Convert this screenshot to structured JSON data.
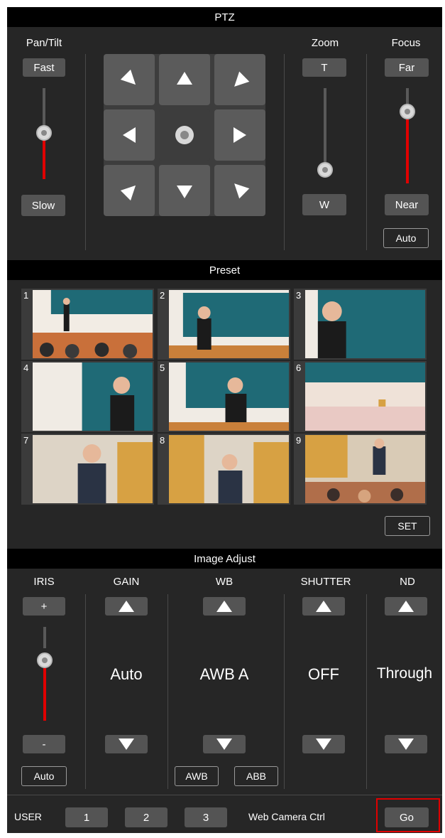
{
  "ptz": {
    "title": "PTZ",
    "pan_tilt": {
      "label": "Pan/Tilt",
      "fast": "Fast",
      "slow": "Slow"
    },
    "zoom": {
      "label": "Zoom",
      "tele": "T",
      "wide": "W"
    },
    "focus": {
      "label": "Focus",
      "far": "Far",
      "near": "Near",
      "auto": "Auto"
    }
  },
  "preset": {
    "title": "Preset",
    "items": [
      {
        "number": "1"
      },
      {
        "number": "2"
      },
      {
        "number": "3"
      },
      {
        "number": "4"
      },
      {
        "number": "5"
      },
      {
        "number": "6"
      },
      {
        "number": "7"
      },
      {
        "number": "8"
      },
      {
        "number": "9"
      }
    ],
    "set_label": "SET"
  },
  "image_adjust": {
    "title": "Image Adjust",
    "iris": {
      "label": "IRIS",
      "plus": "+",
      "minus": "-",
      "auto": "Auto"
    },
    "gain": {
      "label": "GAIN",
      "value": "Auto"
    },
    "wb": {
      "label": "WB",
      "value": "AWB A",
      "awb": "AWB",
      "abb": "ABB"
    },
    "shutter": {
      "label": "SHUTTER",
      "value": "OFF"
    },
    "nd": {
      "label": "ND",
      "value": "Through"
    }
  },
  "footer": {
    "user_label": "USER",
    "user_buttons": [
      "1",
      "2",
      "3"
    ],
    "web_camera_label": "Web Camera Ctrl",
    "go_label": "Go"
  },
  "colors": {
    "background": "#262626",
    "header": "#000000",
    "button": "#545454",
    "slider_active": "#e00000",
    "highlight": "#e00000",
    "chalkboard": "#1f6a76",
    "wood": "#d7a143"
  }
}
